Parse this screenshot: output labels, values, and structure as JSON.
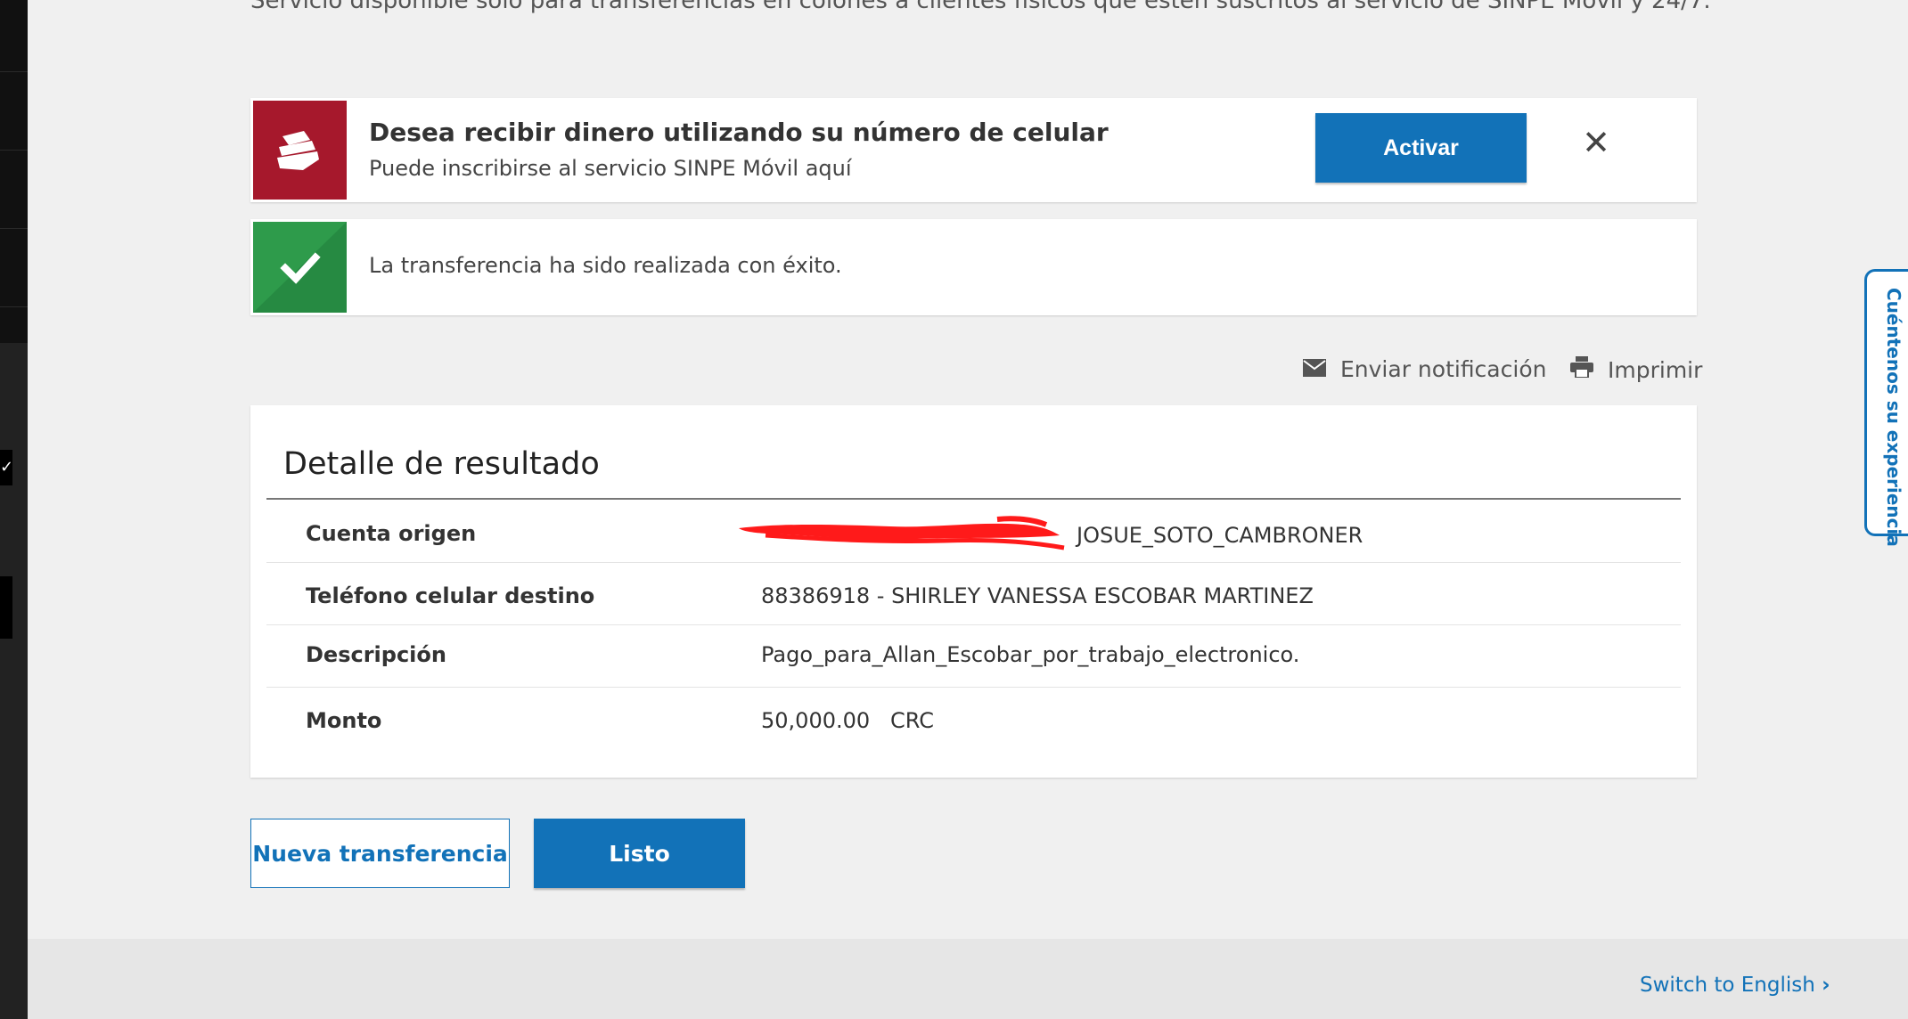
{
  "top_note": "Servicio disponible solo para transferencias en colones a clientes físicos que estén suscritos al servicio de SINPE Móvil y 24/7.",
  "promo": {
    "title": "Desea recibir dinero utilizando su número de celular",
    "subtitle": "Puede inscribirse al servicio SINPE Móvil aquí",
    "activate_label": "Activar",
    "close_glyph": "✕",
    "icon": "sinpe-logo-icon",
    "color": "#a6182c"
  },
  "success": {
    "message": "La transferencia ha sido realizada con éxito.",
    "icon": "checkmark-icon",
    "color": "#2e9b4b"
  },
  "actions": {
    "notify_label": "Enviar notificación",
    "print_label": "Imprimir"
  },
  "detail": {
    "title": "Detalle de resultado",
    "rows": [
      {
        "label": "Cuenta origen",
        "value": "JOSUE_SOTO_CAMBRONER"
      },
      {
        "label": "Teléfono celular destino",
        "value": "88386918 - SHIRLEY VANESSA ESCOBAR MARTINEZ"
      },
      {
        "label": "Descripción",
        "value": "Pago_para_Allan_Escobar_por_trabajo_electronico."
      },
      {
        "label": "Monto",
        "value": "50,000.00   CRC"
      }
    ]
  },
  "buttons": {
    "new_transfer": "Nueva transferencia",
    "done": "Listo"
  },
  "footer": {
    "switch_language": "Switch to English",
    "switch_icon": "chevron-right-icon"
  },
  "feedback_tab": "Cuéntenos su experiencia",
  "accent_color": "#1272b8"
}
